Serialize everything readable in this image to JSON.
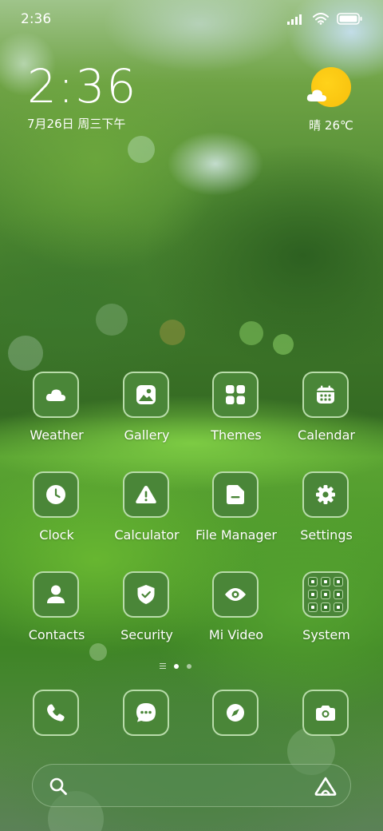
{
  "status_bar": {
    "time": "2:36",
    "icons": [
      "signal-icon",
      "wifi-icon",
      "battery-icon"
    ]
  },
  "clock_widget": {
    "time": "2:36",
    "date": "7月26日 周三下午"
  },
  "weather_widget": {
    "icon": "sun-cloud-icon",
    "text": "晴 26℃"
  },
  "apps": [
    {
      "label": "Weather",
      "icon": "cloud-icon"
    },
    {
      "label": "Gallery",
      "icon": "image-icon"
    },
    {
      "label": "Themes",
      "icon": "grid-icon"
    },
    {
      "label": "Calendar",
      "icon": "calendar-icon"
    },
    {
      "label": "Clock",
      "icon": "clock-icon"
    },
    {
      "label": "Calculator",
      "icon": "warning-icon"
    },
    {
      "label": "File Manager",
      "icon": "folder-icon"
    },
    {
      "label": "Settings",
      "icon": "gear-icon"
    },
    {
      "label": "Contacts",
      "icon": "person-icon"
    },
    {
      "label": "Security",
      "icon": "shield-icon"
    },
    {
      "label": "Mi Video",
      "icon": "eye-icon"
    },
    {
      "label": "System",
      "icon": "folder-grid-icon"
    }
  ],
  "page_indicator": {
    "pages": 2,
    "active_page": 1
  },
  "dock": [
    {
      "icon": "phone-icon"
    },
    {
      "icon": "message-icon"
    },
    {
      "icon": "compass-icon"
    },
    {
      "icon": "camera-icon"
    }
  ],
  "search_bar": {
    "left_icon": "search-icon",
    "right_icon": "assistant-icon"
  },
  "colors": {
    "icon_bg": "#4a8638",
    "icon_border": "#cdebbe",
    "sun": "#ffd21a",
    "text": "#ffffff"
  }
}
